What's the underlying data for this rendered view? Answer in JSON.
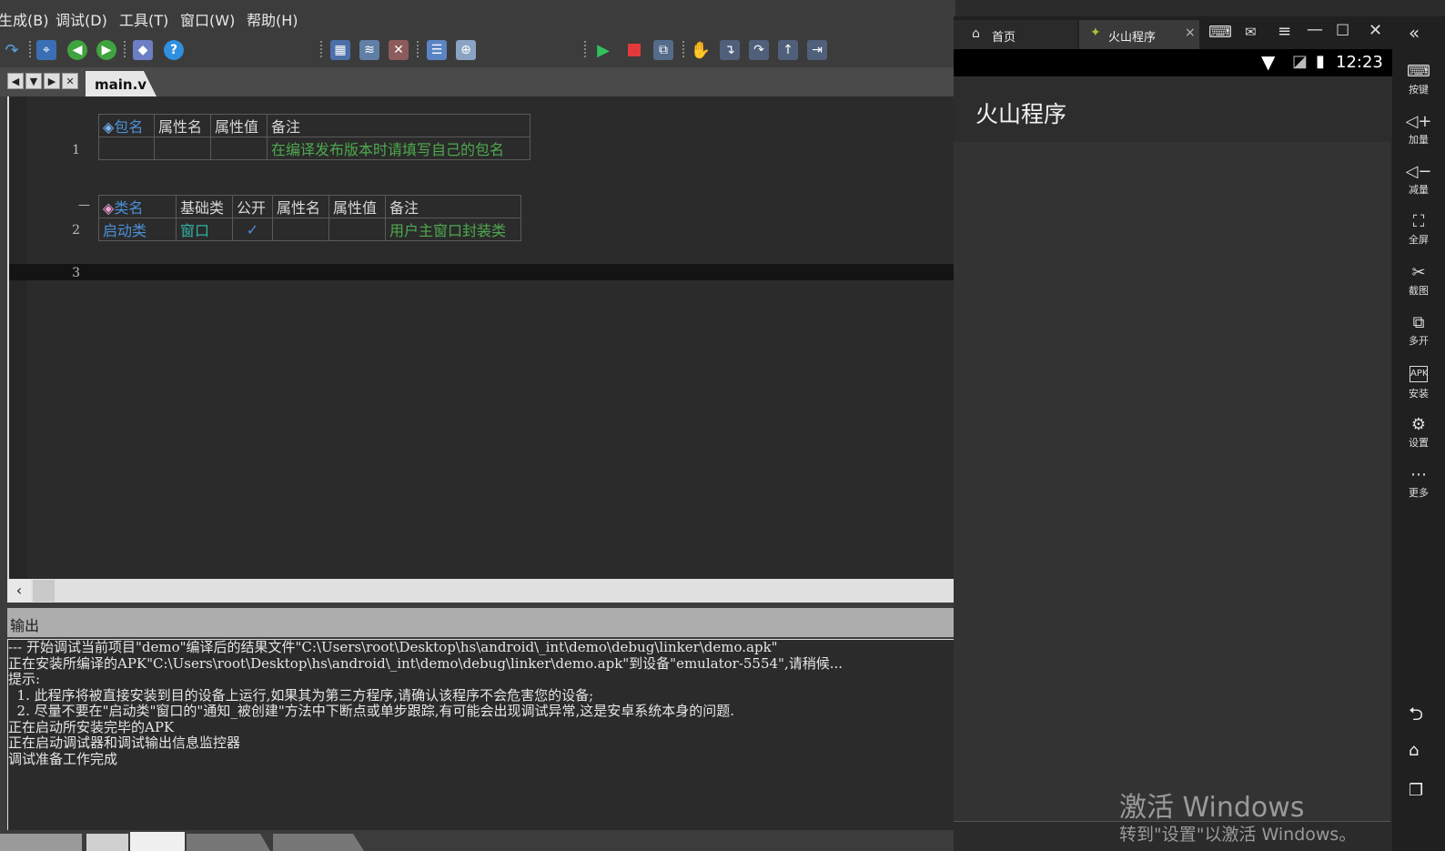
{
  "menu": [
    "生成(B)",
    "调试(D)",
    "工具(T)",
    "窗口(W)",
    "帮助(H)"
  ],
  "file_tab": "main.v",
  "editor": {
    "line_numbers": [
      "1",
      "2",
      "3"
    ],
    "collapse_marker": "—",
    "package_table": {
      "headers": [
        "包名",
        "属性名",
        "属性值",
        "备注"
      ],
      "row": [
        "",
        "",
        "",
        "在编译发布版本时请填写自己的包名"
      ]
    },
    "class_table": {
      "headers": [
        "类名",
        "基础类",
        "公开",
        "属性名",
        "属性值",
        "备注"
      ],
      "row": [
        "启动类",
        "窗口",
        "✓",
        "",
        "",
        "用户主窗口封装类"
      ]
    }
  },
  "output": {
    "title": "输出",
    "lines": [
      "--- 开始调试当前项目\"demo\"编译后的结果文件\"C:\\Users\\root\\Desktop\\hs\\android\\_int\\demo\\debug\\linker\\demo.apk\"",
      "正在安装所编译的APK\"C:\\Users\\root\\Desktop\\hs\\android\\_int\\demo\\debug\\linker\\demo.apk\"到设备\"emulator-5554\",请稍候...",
      "提示:",
      "  1. 此程序将被直接安装到目的设备上运行,如果其为第三方程序,请确认该程序不会危害您的设备;",
      "  2. 尽量不要在\"启动类\"窗口的\"通知_被创建\"方法中下断点或单步跟踪,有可能会出现调试异常,这是安卓系统本身的问题.",
      "正在启动所安装完毕的APK",
      "正在启动调试器和调试输出信息监控器",
      "调试准备工作完成"
    ]
  },
  "emulator": {
    "tabs": [
      "首页",
      "火山程序"
    ],
    "tab_close": "×",
    "clock": "12:23",
    "app_title": "火山程序",
    "sidebar": [
      "按键",
      "加量",
      "减量",
      "全屏",
      "截图",
      "多开",
      "安装",
      "设置",
      "更多"
    ],
    "watermark_line1": "激活 Windows",
    "watermark_line2": "转到\"设置\"以激活 Windows。"
  }
}
